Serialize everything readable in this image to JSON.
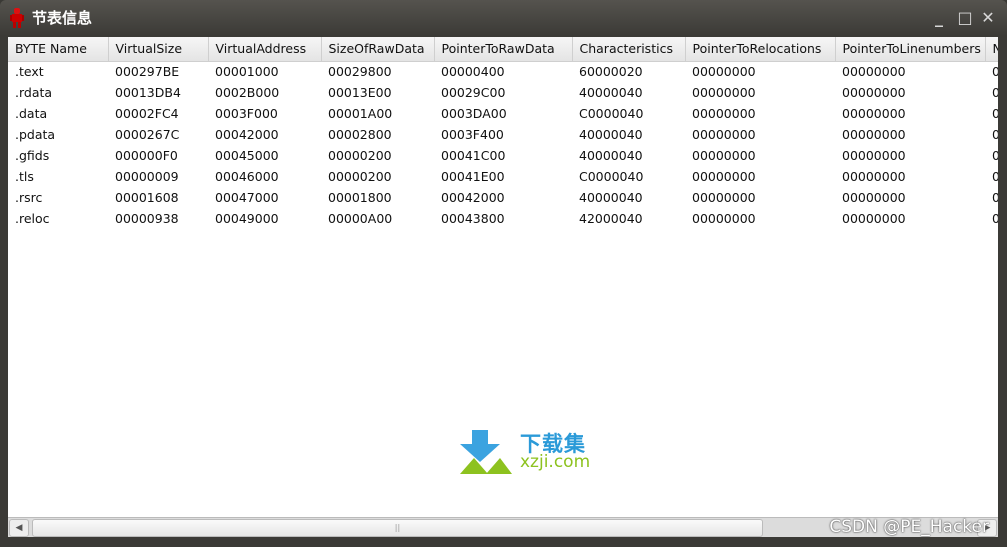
{
  "window": {
    "title": "节表信息",
    "icon": "red-robot-icon",
    "controls": [
      "minimize",
      "maximize",
      "close"
    ]
  },
  "table": {
    "columns": [
      "BYTE Name",
      "VirtualSize",
      "VirtualAddress",
      "SizeOfRawData",
      "PointerToRawData",
      "Characteristics",
      "PointerToRelocations",
      "PointerToLinenumbers",
      "N"
    ],
    "rows": [
      [
        ".text",
        "000297BE",
        "00001000",
        "00029800",
        "00000400",
        "60000020",
        "00000000",
        "00000000",
        "0"
      ],
      [
        ".rdata",
        "00013DB4",
        "0002B000",
        "00013E00",
        "00029C00",
        "40000040",
        "00000000",
        "00000000",
        "0"
      ],
      [
        ".data",
        "00002FC4",
        "0003F000",
        "00001A00",
        "0003DA00",
        "C0000040",
        "00000000",
        "00000000",
        "0"
      ],
      [
        ".pdata",
        "0000267C",
        "00042000",
        "00002800",
        "0003F400",
        "40000040",
        "00000000",
        "00000000",
        "0"
      ],
      [
        ".gfids",
        "000000F0",
        "00045000",
        "00000200",
        "00041C00",
        "40000040",
        "00000000",
        "00000000",
        "0"
      ],
      [
        ".tls",
        "00000009",
        "00046000",
        "00000200",
        "00041E00",
        "C0000040",
        "00000000",
        "00000000",
        "0"
      ],
      [
        ".rsrc",
        "00001608",
        "00047000",
        "00001800",
        "00042000",
        "40000040",
        "00000000",
        "00000000",
        "0"
      ],
      [
        ".reloc",
        "00000938",
        "00049000",
        "00000A00",
        "00043800",
        "42000040",
        "00000000",
        "00000000",
        "0"
      ]
    ]
  },
  "watermark_logo": {
    "text_cn": "下载集",
    "text_en": "xzji.com"
  },
  "watermark_csdn": "CSDN @PE_Hacker"
}
